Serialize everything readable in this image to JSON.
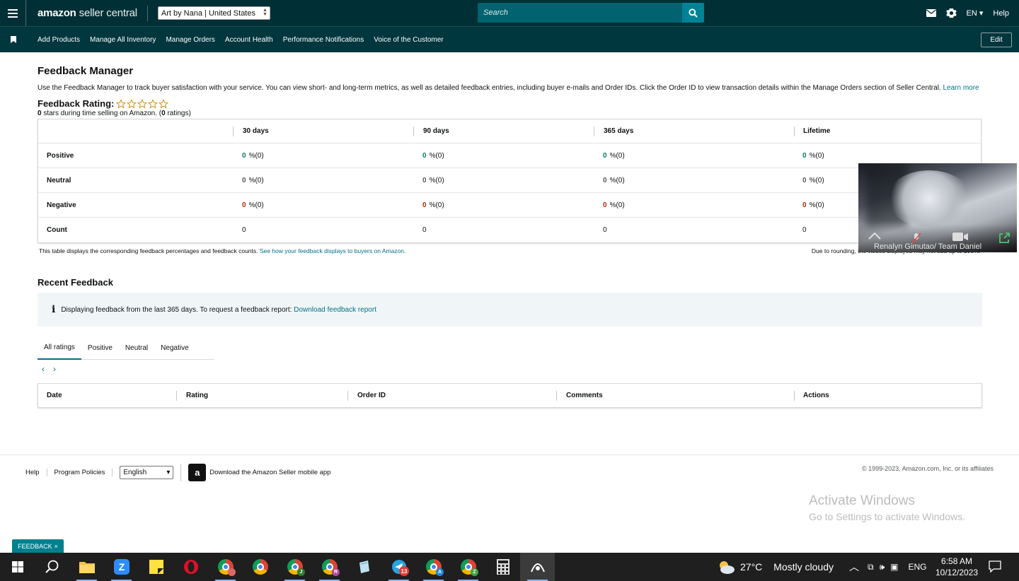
{
  "header": {
    "logo_bold": "amazon",
    "logo_rest": "seller central",
    "store": "Art by Nana | United States",
    "search_placeholder": "Search",
    "lang": "EN",
    "help": "Help"
  },
  "nav": {
    "items": [
      {
        "label": "Add Products"
      },
      {
        "label": "Manage All Inventory"
      },
      {
        "label": "Manage Orders"
      },
      {
        "label": "Account Health"
      },
      {
        "label": "Performance Notifications"
      },
      {
        "label": "Voice of the Customer"
      }
    ],
    "edit": "Edit"
  },
  "page": {
    "title": "Feedback Manager",
    "intro": "Use the Feedback Manager to track buyer satisfaction with your service. You can view short- and long-term metrics, as well as detailed feedback entries, including buyer e-mails and Order IDs. Click the Order ID to view transaction details within the Manage Orders section of Seller Central.",
    "learn_more": "Learn more",
    "rating_label": "Feedback Rating:",
    "stars_value": 0,
    "stars_max": 5,
    "stars_count": "0",
    "stars_text": "stars during time selling on Amazon. (",
    "ratings_count": "0",
    "ratings_text": "ratings)"
  },
  "feedback_table": {
    "columns": [
      "30 days",
      "90 days",
      "365 days",
      "Lifetime"
    ],
    "rows": [
      {
        "label": "Positive",
        "values": [
          "0",
          "0",
          "0",
          "0"
        ],
        "suffix": "%(0)",
        "kind": "pos"
      },
      {
        "label": "Neutral",
        "values": [
          "0",
          "0",
          "0",
          "0"
        ],
        "suffix": "%(0)",
        "kind": "neu"
      },
      {
        "label": "Negative",
        "values": [
          "0",
          "0",
          "0",
          "0"
        ],
        "suffix": "%(0)",
        "kind": "neg"
      },
      {
        "label": "Count",
        "values": [
          "0",
          "0",
          "0",
          "0"
        ],
        "suffix": "",
        "kind": "count"
      }
    ],
    "note_left": "This table displays the corresponding feedback percentages and feedback counts.",
    "note_link": "See how your feedback displays to buyers on Amazon.",
    "note_right": "Due to rounding, the values displayed may not add up to 100%."
  },
  "recent": {
    "title": "Recent Feedback",
    "info_text": "Displaying feedback from the last 365 days. To request a feedback report:",
    "info_link": "Download feedback report",
    "tabs": [
      {
        "label": "All ratings"
      },
      {
        "label": "Positive"
      },
      {
        "label": "Neutral"
      },
      {
        "label": "Negative"
      }
    ],
    "columns": [
      "Date",
      "Rating",
      "Order ID",
      "Comments",
      "Actions"
    ]
  },
  "footer": {
    "help": "Help",
    "policies": "Program Policies",
    "language": "English",
    "app_text": "Download the Amazon Seller mobile app",
    "copyright": "© 1999-2023, Amazon.com, Inc. or its affiliates"
  },
  "video": {
    "name": "Renalyn Gimutao/ Team Daniel"
  },
  "watermark": {
    "line1": "Activate Windows",
    "line2": "Go to Settings to activate Windows."
  },
  "feedback_tab": {
    "label": "FEEDBACK"
  },
  "taskbar": {
    "badge_count": "13",
    "temperature": "27°C",
    "weather": "Mostly cloudy",
    "lang": "ENG",
    "time": "6:58 AM",
    "date": "10/12/2023"
  },
  "colors": {
    "header_bg": "#002f36",
    "nav_bg": "#00363d",
    "link": "#007185",
    "positive": "#067d62",
    "negative": "#b12704"
  }
}
